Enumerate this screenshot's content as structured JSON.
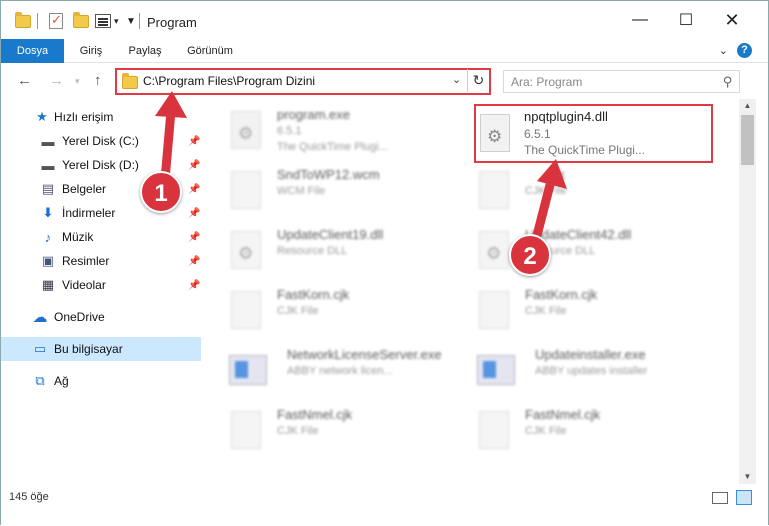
{
  "window": {
    "title": "Program"
  },
  "ribbon": {
    "tabs": [
      "Dosya",
      "Giriş",
      "Paylaş",
      "Görünüm"
    ]
  },
  "address": {
    "path": "C:\\Program Files\\Program Dizini"
  },
  "search": {
    "placeholder": "Ara: Program"
  },
  "nav": {
    "quick_access": "Hızlı erişim",
    "items": [
      "Yerel Disk (C:)",
      "Yerel Disk (D:)",
      "Belgeler",
      "İndirmeler",
      "Müzik",
      "Resimler",
      "Videolar"
    ],
    "onedrive": "OneDrive",
    "this_pc": "Bu bilgisayar",
    "network": "Ağ"
  },
  "files": {
    "highlighted": {
      "name": "npqtplugin4.dll",
      "version": "6.5.1",
      "desc": "The QuickTime Plugi..."
    },
    "left": [
      {
        "name": "program.exe",
        "sub1": "6.5.1",
        "sub2": "The QuickTime Plugi..."
      },
      {
        "name": "SndToWP12.wcm",
        "sub1": "WCM File"
      },
      {
        "name": "UpdateClient19.dll",
        "sub1": "Resource DLL"
      },
      {
        "name": "FastKorn.cjk",
        "sub1": "CJK File"
      },
      {
        "name": "NetworkLicenseServer.exe",
        "sub1": "ABBY network licen..."
      },
      {
        "name": "FastNmel.cjk",
        "sub1": "CJK File"
      }
    ],
    "right": [
      {
        "name": "cjk",
        "sub1": "CJK File"
      },
      {
        "name": "UpdateClient42.dll",
        "sub1": "Resource DLL"
      },
      {
        "name": "FastKorn.cjk",
        "sub1": "CJK File"
      },
      {
        "name": "Updateinstaller.exe",
        "sub1": "ABBY updates installer"
      },
      {
        "name": "FastNmel.cjk",
        "sub1": "CJK File"
      }
    ]
  },
  "status": {
    "count": "145 öğe"
  },
  "annotations": {
    "badge1": "1",
    "badge2": "2"
  },
  "colors": {
    "accent": "#1979ca",
    "highlight_red": "#e23a44",
    "selected_nav": "#cce8ff"
  }
}
